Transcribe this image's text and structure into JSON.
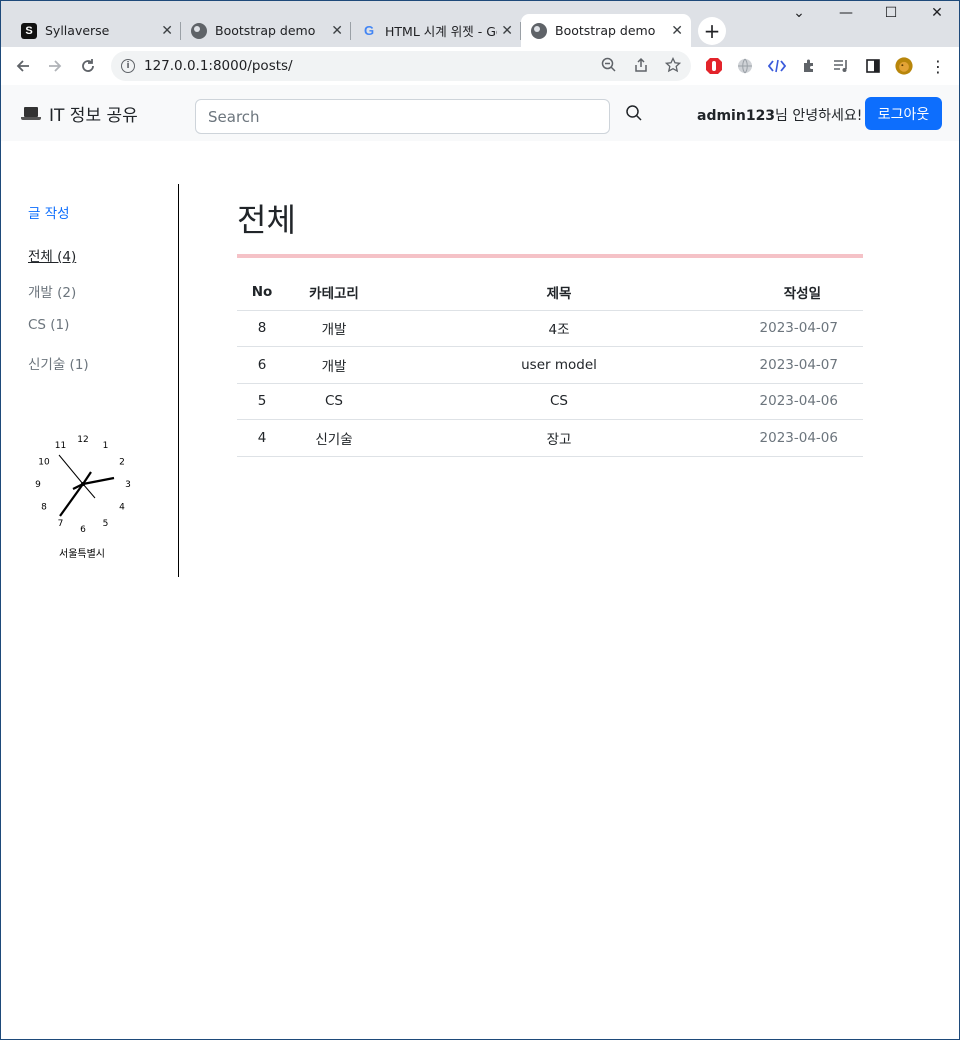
{
  "browser": {
    "tabs": [
      {
        "title": "Syllaverse",
        "favicon": "s-logo-icon",
        "active": false
      },
      {
        "title": "Bootstrap demo",
        "favicon": "globe-icon",
        "active": false
      },
      {
        "title": "HTML 시계 위젯 - Goo",
        "favicon": "google-icon",
        "active": false
      },
      {
        "title": "Bootstrap demo",
        "favicon": "globe-icon",
        "active": true
      }
    ],
    "url": "127.0.0.1:8000/posts/"
  },
  "navbar": {
    "brand": "IT 정보 공유",
    "search_placeholder": "Search",
    "username": "admin123",
    "greeting_suffix": "님 안녕하세요!",
    "logout_label": "로그아웃",
    "accent_color": "#0d6efd"
  },
  "sidebar": {
    "write_label": "글 작성",
    "categories": [
      {
        "label": "전체 (4)",
        "current": true
      },
      {
        "label": "개발 (2)",
        "current": false
      },
      {
        "label": "CS (1)",
        "current": false
      },
      {
        "label": "신기술 (1)",
        "current": false
      }
    ],
    "clock": {
      "numbers": [
        "12",
        "1",
        "2",
        "3",
        "4",
        "5",
        "6",
        "7",
        "8",
        "9",
        "10",
        "11"
      ],
      "caption": "서울특별시"
    }
  },
  "main": {
    "title": "전체",
    "rule_color": "#f5c2c7",
    "columns": [
      "No",
      "카테고리",
      "제목",
      "작성일"
    ],
    "rows": [
      {
        "no": "8",
        "category": "개발",
        "title": "4조",
        "date": "2023-04-07"
      },
      {
        "no": "6",
        "category": "개발",
        "title": "user model",
        "date": "2023-04-07"
      },
      {
        "no": "5",
        "category": "CS",
        "title": "CS",
        "date": "2023-04-06"
      },
      {
        "no": "4",
        "category": "신기술",
        "title": "장고",
        "date": "2023-04-06"
      }
    ]
  }
}
